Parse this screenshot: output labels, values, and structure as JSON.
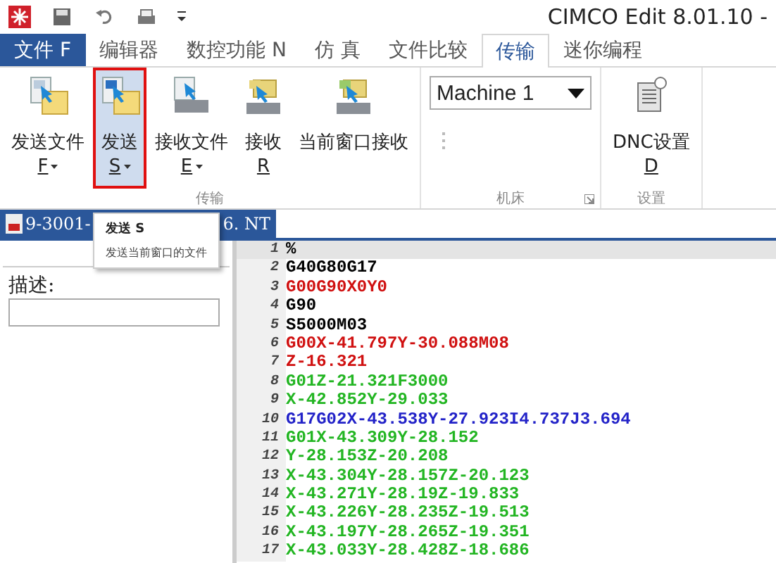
{
  "title_bar": {
    "title": "CIMCO Edit 8.01.10 -"
  },
  "menu_tabs": [
    {
      "label": "文件 F",
      "kind": "file",
      "selected": false
    },
    {
      "label": "编辑器",
      "kind": "tab",
      "selected": false
    },
    {
      "label": "数控功能 N",
      "kind": "tab",
      "selected": false
    },
    {
      "label": "仿 真",
      "kind": "tab",
      "selected": false
    },
    {
      "label": "文件比较",
      "kind": "tab",
      "selected": false
    },
    {
      "label": "传输",
      "kind": "tab",
      "selected": true
    },
    {
      "label": "迷你编程",
      "kind": "tab",
      "selected": false
    }
  ],
  "ribbon_groups": [
    {
      "kind": "buttons",
      "label": "传输",
      "launcher": false,
      "buttons": [
        {
          "kind": "send-file",
          "label": "发送文件",
          "key": "F",
          "dropdown": true,
          "selected": false
        },
        {
          "kind": "send",
          "label": "发送",
          "key": "S",
          "dropdown": true,
          "selected": true
        },
        {
          "kind": "receive-file",
          "label": "接收文件",
          "key": "E",
          "dropdown": true,
          "selected": false
        },
        {
          "kind": "receive",
          "label": "接收",
          "key": "R",
          "dropdown": false,
          "selected": false
        },
        {
          "kind": "receive-window",
          "label": "当前窗口接收",
          "dropdown": false,
          "selected": false
        }
      ]
    },
    {
      "kind": "machine",
      "label": "机床",
      "launcher": true,
      "machine_select": {
        "value": "Machine 1"
      }
    },
    {
      "kind": "buttons",
      "label": "设置",
      "launcher": false,
      "buttons": [
        {
          "kind": "dnc-settings",
          "label": "DNC设置",
          "key": "D",
          "dropdown": false,
          "selected": false
        }
      ]
    }
  ],
  "document_tab": {
    "title_start": "9-3001-",
    "title_end": "6. NT"
  },
  "tooltip": {
    "title": "发送 S",
    "description": "发送当前窗口的文件"
  },
  "description_panel": {
    "label": "描述:"
  },
  "editor": {
    "lines": [
      {
        "number": "1",
        "text": "%",
        "color": "#000000",
        "current": true
      },
      {
        "number": "2",
        "text": "G40G80G17",
        "color": "#000000",
        "current": false
      },
      {
        "number": "3",
        "text": "G00G90X0Y0",
        "color": "#d01010",
        "current": false
      },
      {
        "number": "4",
        "text": "G90",
        "color": "#000000",
        "current": false
      },
      {
        "number": "5",
        "text": "S5000M03",
        "color": "#000000",
        "current": false
      },
      {
        "number": "6",
        "text": "G00X-41.797Y-30.088M08",
        "color": "#d01010",
        "current": false
      },
      {
        "number": "7",
        "text": "Z-16.321",
        "color": "#d01010",
        "current": false
      },
      {
        "number": "8",
        "text": "G01Z-21.321F3000",
        "color": "#22b522",
        "current": false
      },
      {
        "number": "9",
        "text": "X-42.852Y-29.033",
        "color": "#22b522",
        "current": false
      },
      {
        "number": "10",
        "text": "G17G02X-43.538Y-27.923I4.737J3.694",
        "color": "#2222c8",
        "current": false
      },
      {
        "number": "11",
        "text": "G01X-43.309Y-28.152",
        "color": "#22b522",
        "current": false
      },
      {
        "number": "12",
        "text": "Y-28.153Z-20.208",
        "color": "#22b522",
        "current": false
      },
      {
        "number": "13",
        "text": "X-43.304Y-28.157Z-20.123",
        "color": "#22b522",
        "current": false
      },
      {
        "number": "14",
        "text": "X-43.271Y-28.19Z-19.833",
        "color": "#22b522",
        "current": false
      },
      {
        "number": "15",
        "text": "X-43.226Y-28.235Z-19.513",
        "color": "#22b522",
        "current": false
      },
      {
        "number": "16",
        "text": "X-43.197Y-28.265Z-19.351",
        "color": "#22b522",
        "current": false
      },
      {
        "number": "17",
        "text": "X-43.033Y-28.428Z-18.686",
        "color": "#22b522",
        "current": false
      }
    ]
  }
}
